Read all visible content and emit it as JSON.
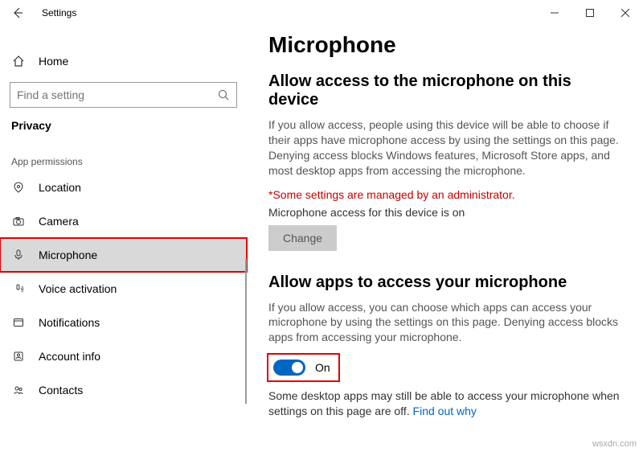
{
  "window": {
    "title": "Settings"
  },
  "sidebar": {
    "home": "Home",
    "search_placeholder": "Find a setting",
    "group": "Privacy",
    "section": "App permissions",
    "items": [
      {
        "label": "Location"
      },
      {
        "label": "Camera"
      },
      {
        "label": "Microphone"
      },
      {
        "label": "Voice activation"
      },
      {
        "label": "Notifications"
      },
      {
        "label": "Account info"
      },
      {
        "label": "Contacts"
      }
    ]
  },
  "page": {
    "title": "Microphone",
    "section1": {
      "head": "Allow access to the microphone on this device",
      "body": "If you allow access, people using this device will be able to choose if their apps have microphone access by using the settings on this page. Denying access blocks Windows features, Microsoft Store apps, and most desktop apps from accessing the microphone.",
      "admin": "*Some settings are managed by an administrator.",
      "access": "Microphone access for this device is on",
      "change": "Change"
    },
    "section2": {
      "head": "Allow apps to access your microphone",
      "body": "If you allow access, you can choose which apps can access your microphone by using the settings on this page. Denying access blocks apps from accessing your microphone.",
      "toggle": "On",
      "footer": "Some desktop apps may still be able to access your microphone when settings on this page are off. ",
      "link": "Find out why"
    }
  },
  "watermark": "wsxdn.com"
}
